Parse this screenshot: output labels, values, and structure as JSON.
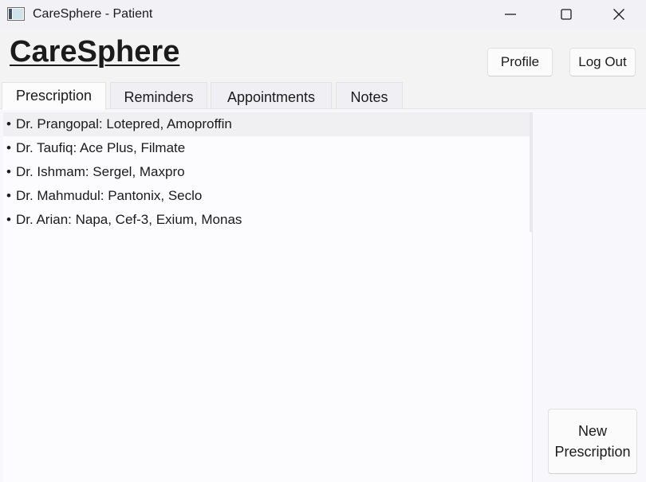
{
  "window": {
    "title": "CareSphere - Patient",
    "minimize_icon": "minimize-icon",
    "maximize_icon": "maximize-icon",
    "close_icon": "close-icon"
  },
  "header": {
    "brand": "CareSphere",
    "profile_label": "Profile",
    "logout_label": "Log Out"
  },
  "tabs": [
    {
      "label": "Prescription",
      "active": true
    },
    {
      "label": "Reminders",
      "active": false
    },
    {
      "label": "Appointments",
      "active": false
    },
    {
      "label": "Notes",
      "active": false
    }
  ],
  "prescriptions": {
    "bullet": "•",
    "items": [
      {
        "text": "Dr. Prangopal: Lotepred, Amoproffin",
        "selected": true
      },
      {
        "text": "Dr. Taufiq: Ace Plus, Filmate",
        "selected": false
      },
      {
        "text": "Dr. Ishmam: Sergel, Maxpro",
        "selected": false
      },
      {
        "text": "Dr. Mahmudul: Pantonix, Seclo",
        "selected": false
      },
      {
        "text": "Dr. Arian: Napa, Cef-3, Exium, Monas",
        "selected": false
      }
    ]
  },
  "actions": {
    "new_prescription_label": "New\nPrescription"
  },
  "colors": {
    "background": "#f3f3f3",
    "text": "#1b1b1b",
    "selected_row": "#f0eff2"
  }
}
